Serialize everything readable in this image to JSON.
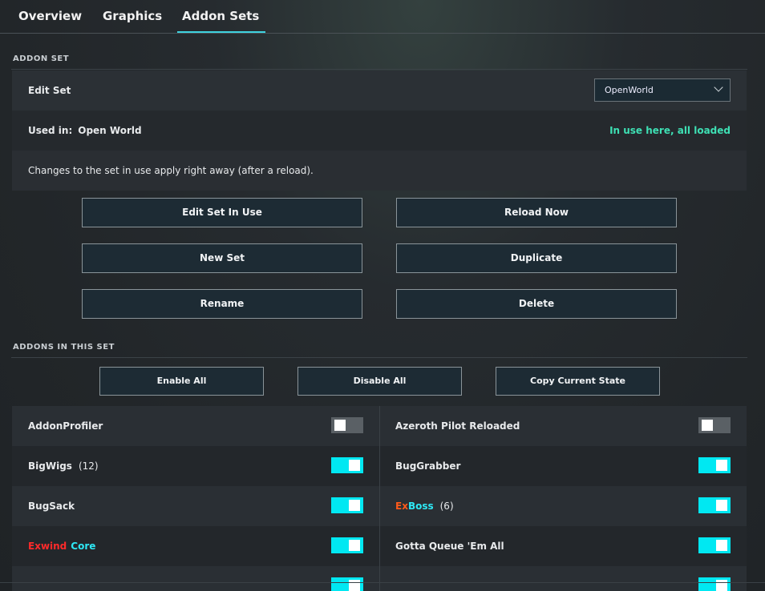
{
  "tabs": [
    {
      "label": "Overview",
      "active": false
    },
    {
      "label": "Graphics",
      "active": false
    },
    {
      "label": "Addon Sets",
      "active": true
    }
  ],
  "addon_set": {
    "section_title": "ADDON SET",
    "edit_label": "Edit Set",
    "selected_set": "OpenWorld",
    "used_in_label": "Used in:",
    "used_in_value": "Open World",
    "status": "In use here, all loaded",
    "info": "Changes to the set in use apply right away (after a reload).",
    "buttons": {
      "edit_in_use": "Edit Set In Use",
      "reload_now": "Reload Now",
      "new_set": "New Set",
      "duplicate": "Duplicate",
      "rename": "Rename",
      "delete": "Delete"
    }
  },
  "addons": {
    "section_title": "ADDONS IN THIS SET",
    "buttons": {
      "enable_all": "Enable All",
      "disable_all": "Disable All",
      "copy_state": "Copy Current State"
    },
    "left": [
      {
        "name": "AddonProfiler",
        "count": "",
        "enabled": false
      },
      {
        "name": "BigWigs",
        "count": "(12)",
        "enabled": true
      },
      {
        "name": "BugSack",
        "count": "",
        "enabled": true
      },
      {
        "name_part1": "Exwind",
        "name_part2": "Core",
        "count": "",
        "enabled": true
      },
      {
        "name": "",
        "count": "",
        "enabled": true
      }
    ],
    "right": [
      {
        "name": "Azeroth Pilot Reloaded",
        "count": "",
        "enabled": false
      },
      {
        "name": "BugGrabber",
        "count": "",
        "enabled": true
      },
      {
        "name_part1": "Ex",
        "name_part2": "Boss",
        "count": "(6)",
        "enabled": true
      },
      {
        "name": "Gotta Queue 'Em All",
        "count": "",
        "enabled": true
      },
      {
        "name": "",
        "count": "",
        "enabled": true
      }
    ]
  },
  "colors": {
    "accent": "#3fd3e0",
    "toggle_on": "#00e8f2",
    "status_green": "#3ee0b4",
    "exwind_red": "#ff2a2a",
    "exboss_orange": "#ff5a1a",
    "core_cyan": "#2ee8f5"
  }
}
